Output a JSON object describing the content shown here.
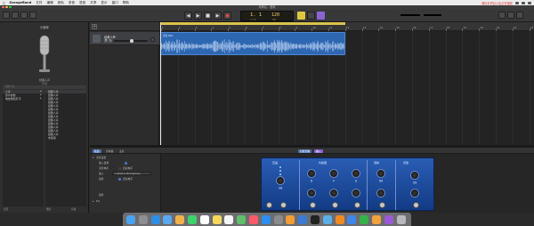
{
  "menubar": {
    "app_name": "GarageBand",
    "items": [
      "文件",
      "编辑",
      "音轨",
      "录音",
      "混音",
      "共享",
      "显示",
      "窗口",
      "帮助"
    ],
    "right_text": "储存本项目以及正在播放"
  },
  "window": {
    "title": "未命名 - 音轨"
  },
  "controlbar": {
    "position": "1. 1",
    "tempo": "120",
    "position_sub": "小节    拍",
    "tempo_sub": "速度"
  },
  "library": {
    "header": "乐器库",
    "mic_label": "经典人声",
    "mic_sub": "声音",
    "search_placeholder": "搜索声音",
    "col1": [
      "人声",
      "原声吉他",
      "电吉他和贝司"
    ],
    "col2": [
      "经典人声",
      "经典人声",
      "经典人声",
      "经典人声",
      "经典人声",
      "经典人声",
      "经典人声",
      "经典人声",
      "经典人声",
      "经典人声",
      "经典人声",
      "经典人声",
      "经典人声",
      "未使用"
    ],
    "footer_left": "还原",
    "footer_mid": "删除",
    "footer_right": "存储"
  },
  "tracks": {
    "add_icon": "plus-icon",
    "track1_name": "经典人声",
    "mute": "M",
    "solo": "S",
    "region_name": "录音 #01"
  },
  "timeline": {
    "bars": [
      "1",
      "2",
      "3",
      "4",
      "5",
      "6",
      "7",
      "8",
      "9",
      "10",
      "11",
      "12",
      "13",
      "14",
      "15",
      "16",
      "17",
      "18",
      "19",
      "20",
      "21",
      "22",
      "23"
    ]
  },
  "smart_controls": {
    "tabs": [
      "轨道",
      "控制器",
      "主控"
    ],
    "right_tabs": [
      "智能控制",
      "输入"
    ],
    "section_title": "录音设置",
    "monitoring": "输入监视",
    "input_label": "输入",
    "input_value": "1 (Built-in Microphone)",
    "level_label": "录音电平",
    "auto_level": "自动电平",
    "gain_label": "插件",
    "eq_label": "EQ",
    "amp_sections": [
      "压缩",
      "均衡器",
      "混响",
      "音量"
    ],
    "amp_knobs": [
      "压缩",
      "低",
      "中",
      "高",
      "混响",
      "音量",
      "预设",
      "增益"
    ]
  },
  "dock": {
    "icons": [
      "finder-icon",
      "launchpad-icon",
      "safari-icon",
      "mail-icon",
      "photos-icon",
      "messages-icon",
      "calendar-icon",
      "notes-icon",
      "reminders-icon",
      "maps-icon",
      "music-icon",
      "appstore-icon",
      "settings-icon",
      "garageband-icon",
      "xcode-icon",
      "terminal-icon",
      "preview-icon",
      "books-icon",
      "keynote-icon",
      "numbers-icon",
      "pages-icon",
      "podcasts-icon",
      "trash-icon"
    ]
  },
  "colors": {
    "accent_blue": "#2e67b1",
    "cycle_yellow": "#d9c24a",
    "lcd_text": "#f5d36a",
    "amp_blue": "#2a5db5"
  }
}
